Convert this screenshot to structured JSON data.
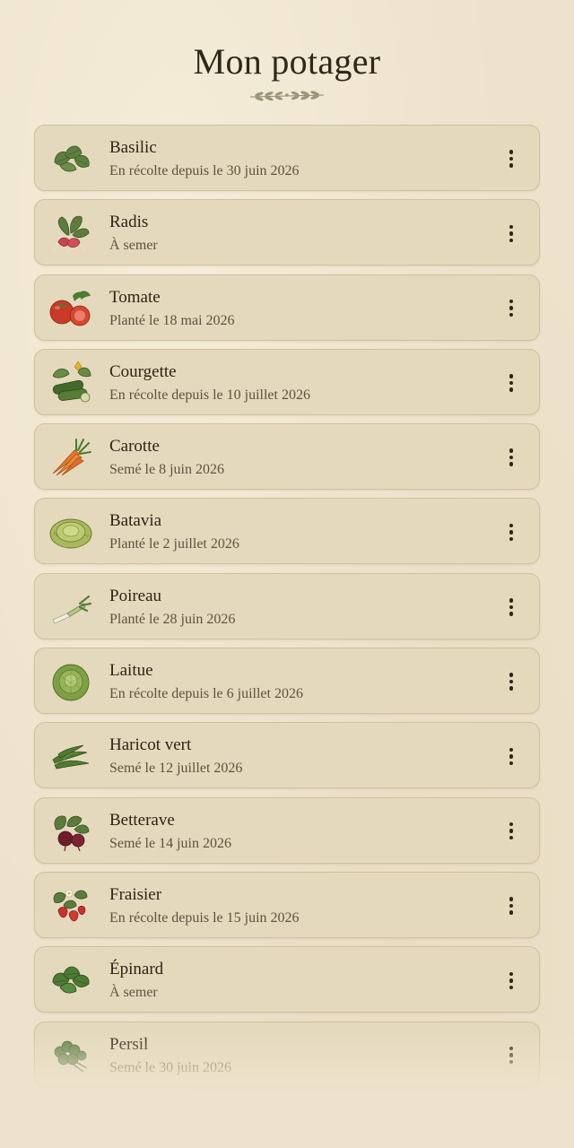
{
  "header": {
    "title": "Mon potager",
    "ornament": "leaf-sprig-icon"
  },
  "plants": [
    {
      "name": "Basilic",
      "status": "En récolte depuis le 30 juin 2026",
      "icon": "basil-icon"
    },
    {
      "name": "Radis",
      "status": "À semer",
      "icon": "radish-icon"
    },
    {
      "name": "Tomate",
      "status": "Planté le 18 mai 2026",
      "icon": "tomato-icon"
    },
    {
      "name": "Courgette",
      "status": "En récolte depuis le 10 juillet 2026",
      "icon": "zucchini-icon"
    },
    {
      "name": "Carotte",
      "status": "Semé le 8 juin 2026",
      "icon": "carrot-icon"
    },
    {
      "name": "Batavia",
      "status": "Planté le 2 juillet 2026",
      "icon": "batavia-icon"
    },
    {
      "name": "Poireau",
      "status": "Planté le 28 juin 2026",
      "icon": "leek-icon"
    },
    {
      "name": "Laitue",
      "status": "En récolte depuis le 6 juillet 2026",
      "icon": "lettuce-icon"
    },
    {
      "name": "Haricot vert",
      "status": "Semé le 12 juillet 2026",
      "icon": "green-bean-icon"
    },
    {
      "name": "Betterave",
      "status": "Semé le 14 juin 2026",
      "icon": "beetroot-icon"
    },
    {
      "name": "Fraisier",
      "status": "En récolte depuis le 15 juin 2026",
      "icon": "strawberry-icon"
    },
    {
      "name": "Épinard",
      "status": "À semer",
      "icon": "spinach-icon"
    },
    {
      "name": "Persil",
      "status": "Semé le 30 juin 2026",
      "icon": "parsley-icon"
    }
  ],
  "colors": {
    "background": "#ede2cb",
    "card": "#e5d9bd",
    "card_border": "#cfc1a0",
    "text": "#2b2416",
    "muted_text": "#5c533f"
  }
}
